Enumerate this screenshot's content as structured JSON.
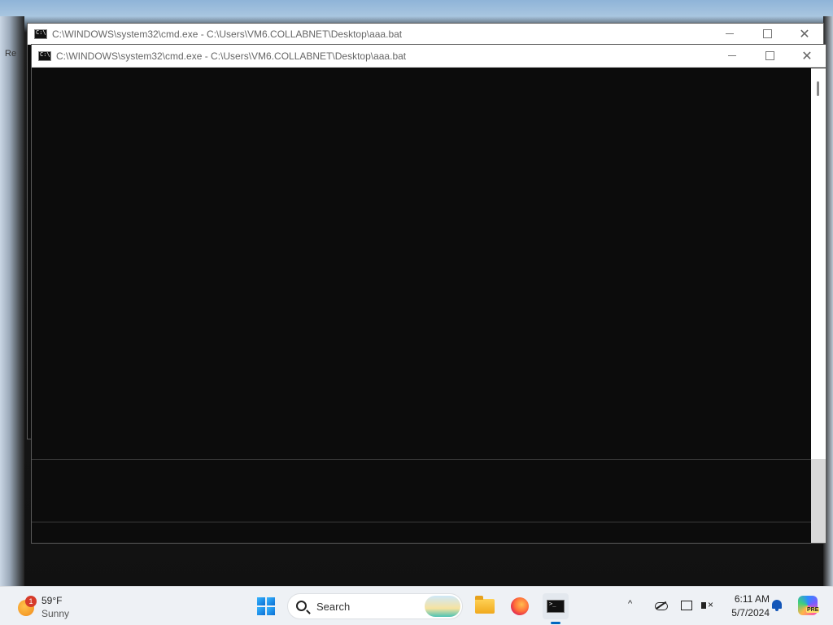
{
  "desktop": {
    "edge_label": "Re"
  },
  "windows": {
    "back": {
      "title": "C:\\WINDOWS\\system32\\cmd.exe - C:\\Users\\VM6.COLLABNET\\Desktop\\aaa.bat",
      "icon": "cmd-icon"
    },
    "front": {
      "title": "C:\\WINDOWS\\system32\\cmd.exe - C:\\Users\\VM6.COLLABNET\\Desktop\\aaa.bat",
      "icon": "cmd-icon",
      "console_background": "#0c0c0c"
    },
    "caption": {
      "minimize": "",
      "maximize": "",
      "close": "✕"
    }
  },
  "taskbar": {
    "weather": {
      "badge": "1",
      "temp": "59°F",
      "condition": "Sunny"
    },
    "search": {
      "placeholder": "Search"
    },
    "pinned": [
      "start-icon",
      "file-explorer-icon",
      "firefox-icon",
      "terminal-icon"
    ],
    "active_app": "terminal-icon",
    "tray": {
      "chevron": "^",
      "time": "6:11 AM",
      "date": "5/7/2024",
      "copilot_badge": "PRE"
    }
  },
  "colors": {
    "accent": "#0067c0",
    "console": "#0c0c0c",
    "taskbar": "#eef1f5"
  }
}
